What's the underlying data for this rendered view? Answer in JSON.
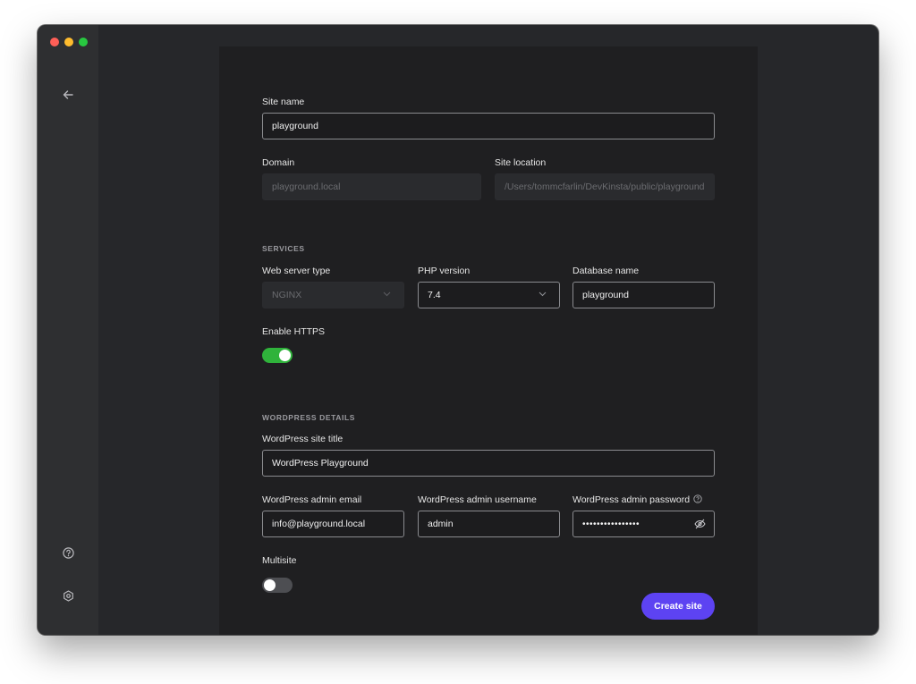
{
  "site_name": {
    "label": "Site name",
    "value": "playground"
  },
  "domain": {
    "label": "Domain",
    "value": "playground.local"
  },
  "site_location": {
    "label": "Site location",
    "value": "/Users/tommcfarlin/DevKinsta/public/playground"
  },
  "services": {
    "heading": "SERVICES",
    "web_server": {
      "label": "Web server type",
      "value": "NGINX"
    },
    "php": {
      "label": "PHP version",
      "value": "7.4"
    },
    "database": {
      "label": "Database name",
      "value": "playground"
    },
    "https": {
      "label": "Enable HTTPS",
      "enabled": true
    }
  },
  "wordpress": {
    "heading": "WORDPRESS DETAILS",
    "site_title": {
      "label": "WordPress site title",
      "value": "WordPress Playground"
    },
    "admin_email": {
      "label": "WordPress admin email",
      "value": "info@playground.local"
    },
    "admin_username": {
      "label": "WordPress admin username",
      "value": "admin"
    },
    "admin_password": {
      "label": "WordPress admin password",
      "value": "••••••••••••••••"
    },
    "multisite": {
      "label": "Multisite",
      "enabled": false
    }
  },
  "actions": {
    "create_label": "Create site"
  },
  "colors": {
    "accent": "#5d43f2",
    "toggle_on": "#2fb33b",
    "background": "#26272a"
  },
  "icons": [
    "back-arrow-icon",
    "help-icon",
    "settings-icon",
    "info-icon",
    "eye-slash-icon",
    "chevron-down-icon"
  ]
}
